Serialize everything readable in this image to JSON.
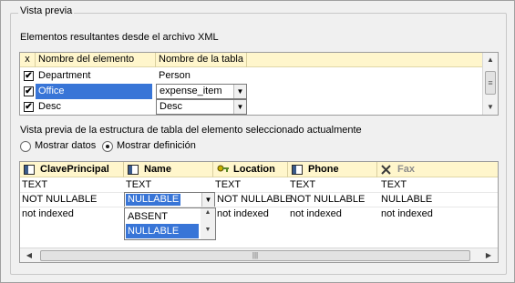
{
  "group": {
    "title": "Vista previa"
  },
  "elements_label": "Elementos resultantes desde el archivo XML",
  "element_list": {
    "headers": {
      "check": "x",
      "name": "Nombre del elemento",
      "table": "Nombre de la tabla"
    },
    "rows": [
      {
        "checked": "✔",
        "name": "Department",
        "table": "Person"
      },
      {
        "checked": "✔",
        "name": "Office",
        "table": "expense_item"
      },
      {
        "checked": "✔",
        "name": "Desc",
        "table": "Desc"
      }
    ]
  },
  "structure_label": "Vista previa de la estructura de tabla del elemento seleccionado actualmente",
  "radios": {
    "show_data": "Mostrar datos",
    "show_definition": "Mostrar definición",
    "selected": "show_definition"
  },
  "grid": {
    "columns": [
      "ClavePrincipal",
      "Name",
      "Location",
      "Phone",
      "Fax"
    ],
    "rows": [
      [
        "TEXT",
        "TEXT",
        "TEXT",
        "TEXT",
        "TEXT"
      ],
      [
        "NOT NULLABLE",
        "NULLABLE",
        "NOT NULLABLE",
        "NOT NULLABLE",
        "NULLABLE"
      ],
      [
        "not indexed",
        "",
        "not indexed",
        "not indexed",
        "not indexed"
      ]
    ],
    "dropdown_options": [
      "ABSENT",
      "NULLABLE"
    ],
    "dropdown_selected": "NULLABLE"
  },
  "colors": {
    "header_bg": "#fff6cc",
    "selection": "#3875d7"
  },
  "icons": {
    "column": "column-icon",
    "key": "key-icon",
    "disabled": "x-icon",
    "dropdown": "chevron-down-icon"
  }
}
